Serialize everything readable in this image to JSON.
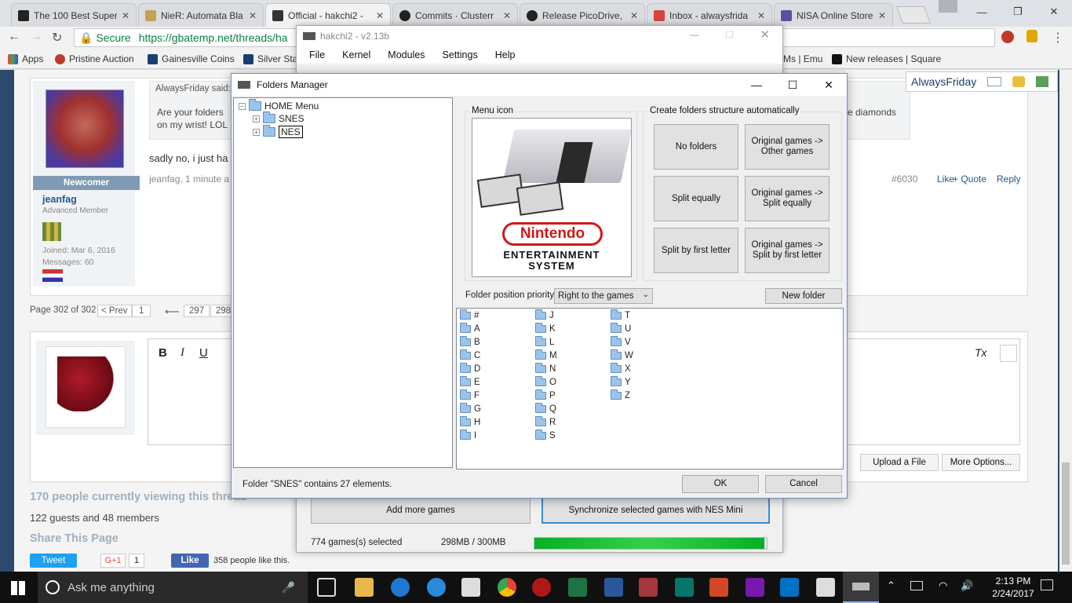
{
  "browser": {
    "tabs": [
      {
        "title": "The 100 Best Super",
        "color": "#222"
      },
      {
        "title": "NieR: Automata Bla",
        "color": "#c8a050"
      },
      {
        "title": "Official - hakchi2 -",
        "color": "#333"
      },
      {
        "title": "Commits · Clusterr",
        "color": "#222"
      },
      {
        "title": "Release PicoDrive,",
        "color": "#222"
      },
      {
        "title": "Inbox - alwaysfrida",
        "color": "#d44638"
      },
      {
        "title": "NISA Online Store",
        "color": "#5a4fa0"
      }
    ],
    "url_secure": "Secure",
    "url": "https://gbatemp.net/threads/ha",
    "bookmarks": [
      "Apps",
      "Pristine Auction",
      "Gainesville Coins",
      "Silver Sta",
      "Ms | Emu",
      "New releases | Square"
    ]
  },
  "forum": {
    "quote_author": "AlwaysFriday said:",
    "quote_text_1": "Are your folders",
    "quote_text_2": "on my wrist! LOL",
    "quote_tail": "e diamonds",
    "post_text": "sadly no, i just ha",
    "post_meta": "jeanfag, 1 minute a",
    "post_number": "#6030",
    "like": "Like",
    "quote": "+ Quote",
    "reply": "Reply",
    "user_rank": "Newcomer",
    "username": "jeanfag",
    "user_title": "Advanced Member",
    "joined": "Joined: Mar 6, 2016",
    "messages": "Messages: 60",
    "logged_user": "AlwaysFriday",
    "pagination": "Page 302 of 302",
    "prev": "< Prev",
    "pages": [
      "1",
      "297",
      "298"
    ],
    "ellipsis": "⟵",
    "upload": "Upload a File",
    "more_options": "More Options...",
    "viewing": "170 people currently viewing this thread",
    "viewing_detail": "122 guests and 48 members",
    "share": "Share This Page",
    "tweet": "Tweet",
    "gplus": "G+1",
    "gplus_count": "1",
    "fb_like": "Like",
    "fb_text": "358 people like this."
  },
  "hakchi": {
    "title": "hakchi2 - v2.13b",
    "menu": [
      "File",
      "Kernel",
      "Modules",
      "Settings",
      "Help"
    ],
    "add_games": "Add more games",
    "sync": "Synchronize selected games with NES Mini",
    "selected": "774 games(s) selected",
    "size": "298MB / 300MB",
    "progress": 0.99
  },
  "folders_manager": {
    "title": "Folders Manager",
    "tree_root": "HOME Menu",
    "tree_children": [
      "SNES",
      "NES"
    ],
    "menu_icon_label": "Menu icon",
    "auto_label": "Create folders structure automatically",
    "buttons": [
      "No folders",
      "Original games ->\nOther games",
      "Split equally",
      "Original games ->\nSplit equally",
      "Split by first letter",
      "Original games ->\nSplit by first letter"
    ],
    "priority_label": "Folder position priority:",
    "priority_value": "Right to the games",
    "new_folder": "New folder",
    "letters": [
      "#",
      "A",
      "B",
      "C",
      "D",
      "E",
      "F",
      "G",
      "H",
      "I",
      "J",
      "K",
      "L",
      "M",
      "N",
      "O",
      "P",
      "Q",
      "R",
      "S",
      "T",
      "U",
      "V",
      "W",
      "X",
      "Y",
      "Z"
    ],
    "status": "Folder \"SNES\" contains 27 elements.",
    "ok": "OK",
    "cancel": "Cancel",
    "logo_line1": "Nintendo",
    "logo_line2": "ENTERTAINMENT",
    "logo_line3": "SYSTEM"
  },
  "taskbar": {
    "search_placeholder": "Ask me anything",
    "time": "2:13 PM",
    "date": "2/24/2017"
  }
}
